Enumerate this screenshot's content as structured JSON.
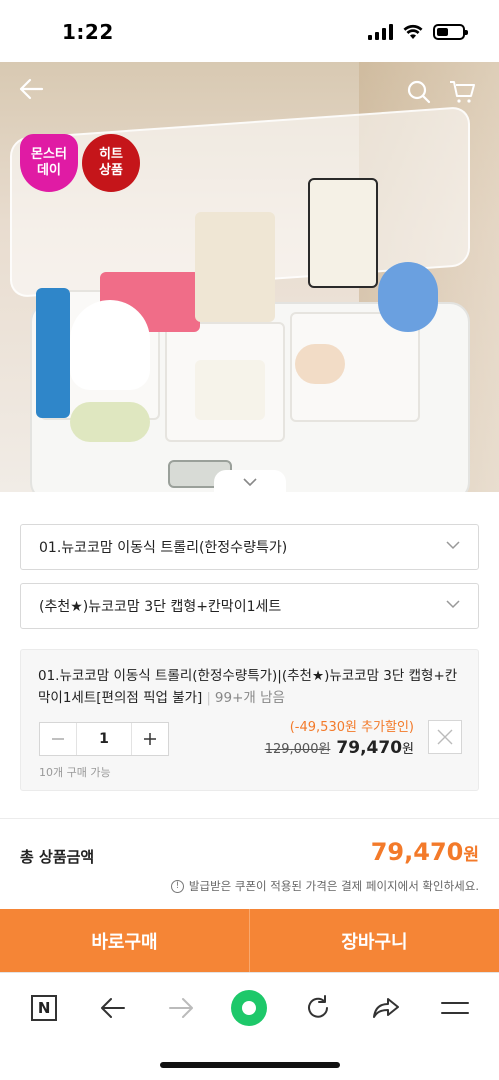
{
  "status_bar": {
    "time": "1:22"
  },
  "hero": {
    "badges": {
      "monster_day": "몬스터\n데이",
      "hit_product": "히트\n상품"
    },
    "icons": {
      "back": "back-arrow-icon",
      "search": "search-icon",
      "cart": "cart-icon",
      "expand": "chevron-down-icon"
    }
  },
  "options": {
    "select_1": "01.뉴코코맘 이동식 트롤리(한정수량특가)",
    "select_2": "(추천★)뉴코코맘 3단 캡형+칸막이1세트"
  },
  "selected_item": {
    "name": "01.뉴코코맘 이동식 트롤리(한정수량특가)|(추천★)뉴코코맘 3단 캡형+칸막이1세트[편의점 픽업 불가]",
    "stock": "99+개 남음",
    "quantity": "1",
    "limit": "10개 구매 가능",
    "discount": "(-49,530원 추가할인)",
    "original_price": "129,000원",
    "final_price": "79,470",
    "final_price_unit": "원"
  },
  "total": {
    "label": "총 상품금액",
    "value": "79,470",
    "unit": "원",
    "coupon_note": "발급받은 쿠폰이 적용된 가격은 결제 페이지에서 확인하세요."
  },
  "buttons": {
    "buy_now": "바로구매",
    "add_to_cart": "장바구니"
  },
  "browser": {
    "n_label": "N"
  },
  "colors": {
    "accent": "#f58536",
    "price_orange": "#f37a2a",
    "home_green": "#1ec86a"
  }
}
